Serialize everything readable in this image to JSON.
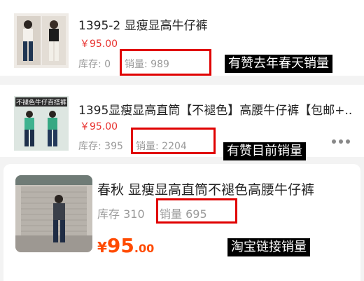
{
  "items": [
    {
      "title": "1395-2 显瘦显高牛仔裤",
      "price": "￥95.00",
      "stock": "库存: 0",
      "sales": "销量: 989",
      "annotation": "有赞去年春天销量"
    },
    {
      "title": "1395显瘦显高直筒【不褪色】高腰牛仔裤【包邮+...",
      "price": "￥95.00",
      "stock": "库存: 395",
      "sales": "销量: 2204",
      "annotation": "有赞目前销量"
    },
    {
      "title": "春秋 显瘦显高直筒不褪色高腰牛仔裤",
      "price_currency": "¥",
      "price_int": "95",
      "price_dec": ".00",
      "stock": "库存 310",
      "sales": "销量 695",
      "annotation": "淘宝链接销量"
    }
  ],
  "thumb2_banner": "不褪色牛仔百搭裤"
}
